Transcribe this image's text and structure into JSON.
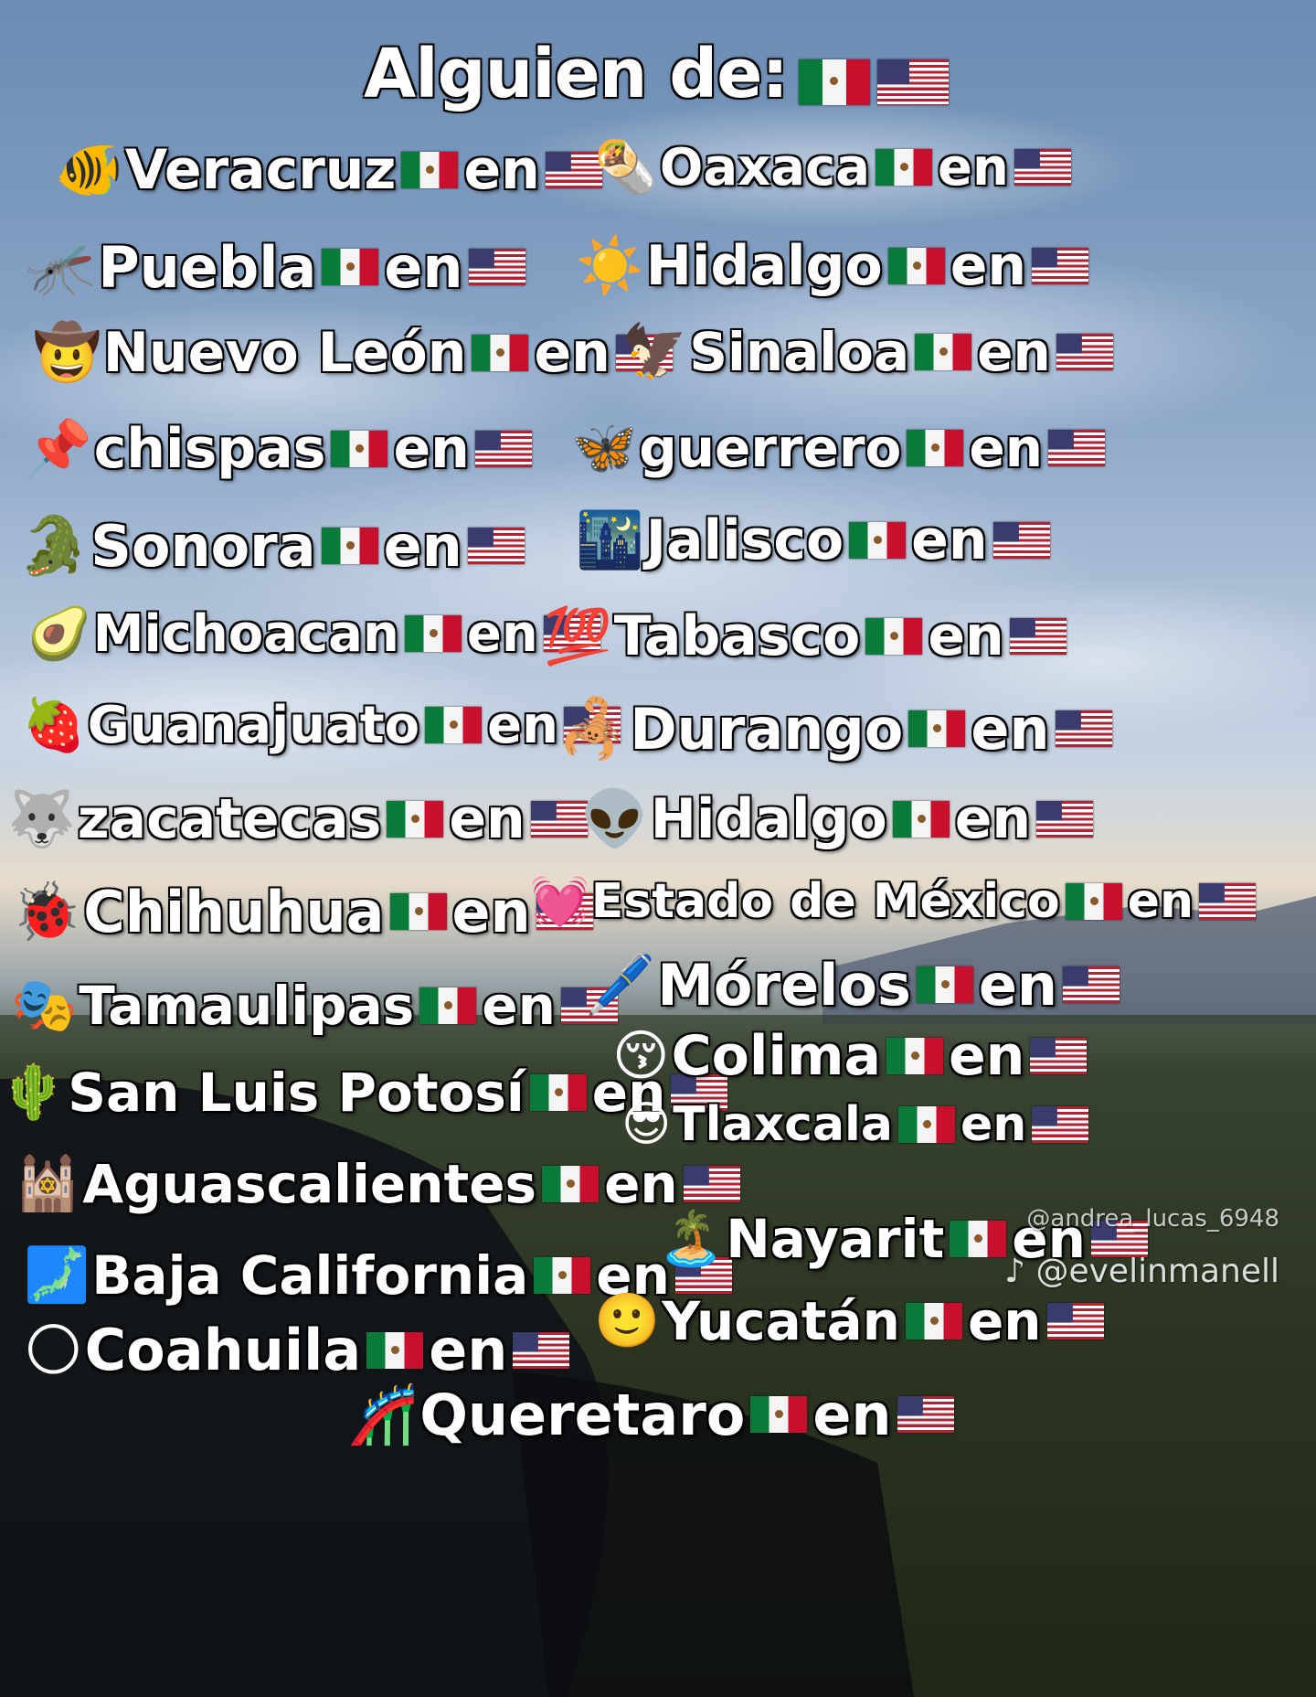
{
  "title": "Alguien de:",
  "connector": "en",
  "watermark": "@evelinmanell",
  "watermark_secondary": "@andrea_lucas_6948",
  "left": [
    {
      "emoji": "🐠",
      "name": "Veracruz"
    },
    {
      "emoji": "🦟",
      "name": "Puebla"
    },
    {
      "emoji": "🤠",
      "name": "Nuevo León"
    },
    {
      "emoji": "📌",
      "name": "chispas"
    },
    {
      "emoji": "🐊",
      "name": "Sonora"
    },
    {
      "emoji": "🥑",
      "name": "Michoacan"
    },
    {
      "emoji": "🍓",
      "name": "Guanajuato"
    },
    {
      "emoji": "🐺",
      "name": "zacatecas"
    },
    {
      "emoji": "🐞",
      "name": "Chihuhua"
    },
    {
      "emoji": "🎭",
      "name": "Tamaulipas"
    },
    {
      "emoji": "🌵",
      "name": "San Luis Potosí"
    },
    {
      "emoji": "🕍",
      "name": "Aguascalientes"
    },
    {
      "emoji": "🗾",
      "name": "Baja California"
    },
    {
      "emoji": "🌕",
      "name": "Coahuila"
    }
  ],
  "right": [
    {
      "emoji": "🌯",
      "name": "Oaxaca"
    },
    {
      "emoji": "☀️",
      "name": "Hidalgo"
    },
    {
      "emoji": "🦅",
      "name": "Sinaloa"
    },
    {
      "emoji": "🦋",
      "name": "guerrero"
    },
    {
      "emoji": "🌃",
      "name": "Jalisco"
    },
    {
      "emoji": "💯",
      "name": "Tabasco"
    },
    {
      "emoji": "🦂",
      "name": "Durango"
    },
    {
      "emoji": "👽",
      "name": "Hidalgo"
    },
    {
      "emoji": "💓",
      "name": "Estado de México"
    },
    {
      "emoji": "🖊️",
      "name": "Mórelos"
    },
    {
      "emoji": "😚",
      "name": "Colima"
    },
    {
      "emoji": "😎",
      "name": "Tlaxcala"
    },
    {
      "emoji": "🏝️",
      "name": "Nayarit"
    },
    {
      "emoji": "🙂",
      "name": "Yucatán"
    }
  ],
  "bottom": {
    "emoji": "🎢",
    "name": "Queretaro"
  },
  "colors": {
    "sky_top": "#6f8fb5",
    "sky_mid": "#c9d6e6",
    "horizon": "#e8d9c0",
    "field": "#3d4a2c",
    "ground_dark": "#15180f"
  }
}
